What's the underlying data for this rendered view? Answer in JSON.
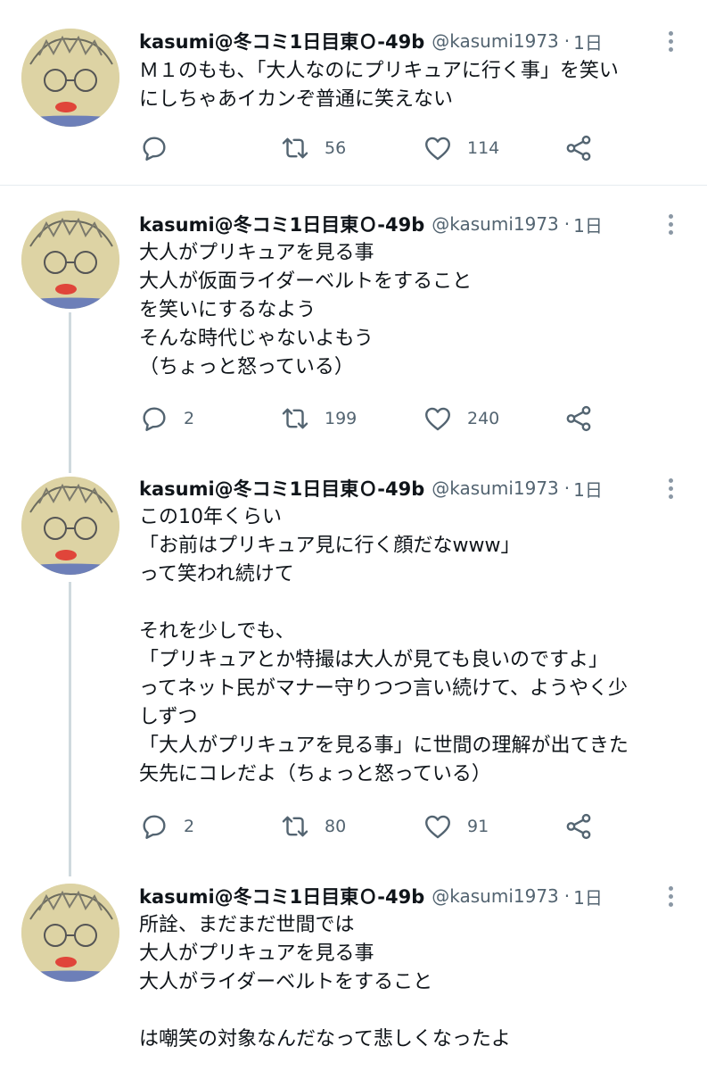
{
  "tweets": [
    {
      "name": "kasumi@冬コミ1日目東Ｏ-49b",
      "handle": "@kasumi1973",
      "separator": "·",
      "time": "1日",
      "lines": [
        "Ｍ１のもも、「大人なのにプリキュアに行く事」を笑い",
        "にしちゃあイカンぞ普通に笑えない"
      ],
      "replies": "",
      "retweets": "56",
      "likes": "114"
    },
    {
      "name": "kasumi@冬コミ1日目東Ｏ-49b",
      "handle": "@kasumi1973",
      "separator": "·",
      "time": "1日",
      "lines": [
        "大人がプリキュアを見る事",
        "大人が仮面ライダーベルトをすること",
        "を笑いにするなよう",
        "そんな時代じゃないよもう",
        "（ちょっと怒っている）"
      ],
      "replies": "2",
      "retweets": "199",
      "likes": "240"
    },
    {
      "name": "kasumi@冬コミ1日目東Ｏ-49b",
      "handle": "@kasumi1973",
      "separator": "·",
      "time": "1日",
      "lines": [
        "この10年くらい",
        "「お前はプリキュア見に行く顔だなwww」",
        "って笑われ続けて",
        "",
        "それを少しでも、",
        "「プリキュアとか特撮は大人が見ても良いのですよ」",
        "ってネット民がマナー守りつつ言い続けて、ようやく少",
        "しずつ",
        "「大人がプリキュアを見る事」に世間の理解が出てきた",
        "矢先にコレだよ（ちょっと怒っている）"
      ],
      "replies": "2",
      "retweets": "80",
      "likes": "91"
    },
    {
      "name": "kasumi@冬コミ1日目東Ｏ-49b",
      "handle": "@kasumi1973",
      "separator": "·",
      "time": "1日",
      "lines": [
        "所詮、まだまだ世間では",
        "大人がプリキュアを見る事",
        "大人がライダーベルトをすること",
        "",
        "は嘲笑の対象なんだなって悲しくなったよ"
      ]
    }
  ],
  "icons": {
    "reply": "reply-icon",
    "retweet": "retweet-icon",
    "like": "heart-icon",
    "share": "share-icon",
    "more": "more-options-icon"
  },
  "colors": {
    "text": "#0f1419",
    "secondary": "#536471",
    "divider": "#e6ecf0",
    "thread_line": "#cfd9de"
  }
}
